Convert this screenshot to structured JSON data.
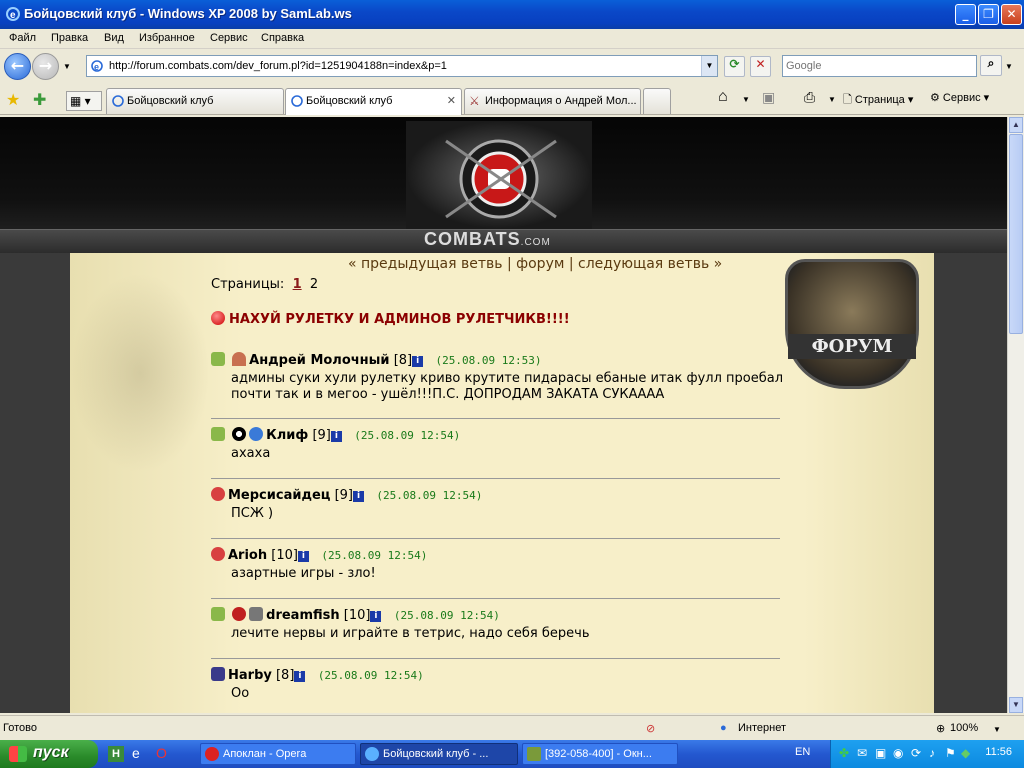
{
  "window": {
    "title": "Бойцовский клуб - Windows XP 2008 by SamLab.ws"
  },
  "menu": [
    "Файл",
    "Правка",
    "Вид",
    "Избранное",
    "Сервис",
    "Справка"
  ],
  "address": {
    "url": "http://forum.combats.com/dev_forum.pl?id=1251904188n=index&p=1"
  },
  "search": {
    "placeholder": "Google"
  },
  "tabs": [
    {
      "label": "Бойцовский клуб"
    },
    {
      "label": "Бойцовский клуб"
    },
    {
      "label": "Информация о Андрей Мол..."
    }
  ],
  "toolbar": {
    "page_label": "Страница",
    "tools_label": "Сервис"
  },
  "site": {
    "brand": "COMBATS",
    "brand_suffix": ".COM",
    "badge": "ФОРУМ",
    "nav": "« предыдущая ветвь | форум | следующая ветвь »",
    "pages_label": "Страницы:",
    "page1": "1",
    "page2": "2",
    "thread_title": "НАХУЙ РУЛЕТКУ И АДМИНОВ РУЛЕТЧИКВ!!!!"
  },
  "posts": [
    {
      "author": "Андрей Молочный",
      "level": "[8]",
      "date": "(25.08.09 12:53)",
      "body": "админы суки хули рулетку криво крутите пидарасы ебаные итак фулл проебал почти так и в мегоо - ушёл!!!П.С. ДОПРОДАМ ЗАКАТА СУКАААА"
    },
    {
      "author": "Клиф",
      "level": "[9]",
      "date": "(25.08.09 12:54)",
      "body": "ахаха"
    },
    {
      "author": "Мерсисайдец",
      "level": "[9]",
      "date": "(25.08.09 12:54)",
      "body": "ПСЖ )"
    },
    {
      "author": "Arioh",
      "level": "[10]",
      "date": "(25.08.09 12:54)",
      "body": "азартные игры - зло!"
    },
    {
      "author": "dreamfish",
      "level": "[10]",
      "date": "(25.08.09 12:54)",
      "body": "лечите нервы и играйте в тетрис, надо себя беречь"
    },
    {
      "author": "Harby",
      "level": "[8]",
      "date": "(25.08.09 12:54)",
      "body": "Оо"
    }
  ],
  "status": {
    "left": "Готово",
    "zone": "Интернет",
    "zoom": "100%"
  },
  "taskbar": {
    "start": "пуск",
    "tasks": [
      "Апоклан - Opera",
      "Бойцовский клуб - ...",
      "[392-058-400] - Окн..."
    ],
    "lang": "EN",
    "time": "11:56"
  }
}
